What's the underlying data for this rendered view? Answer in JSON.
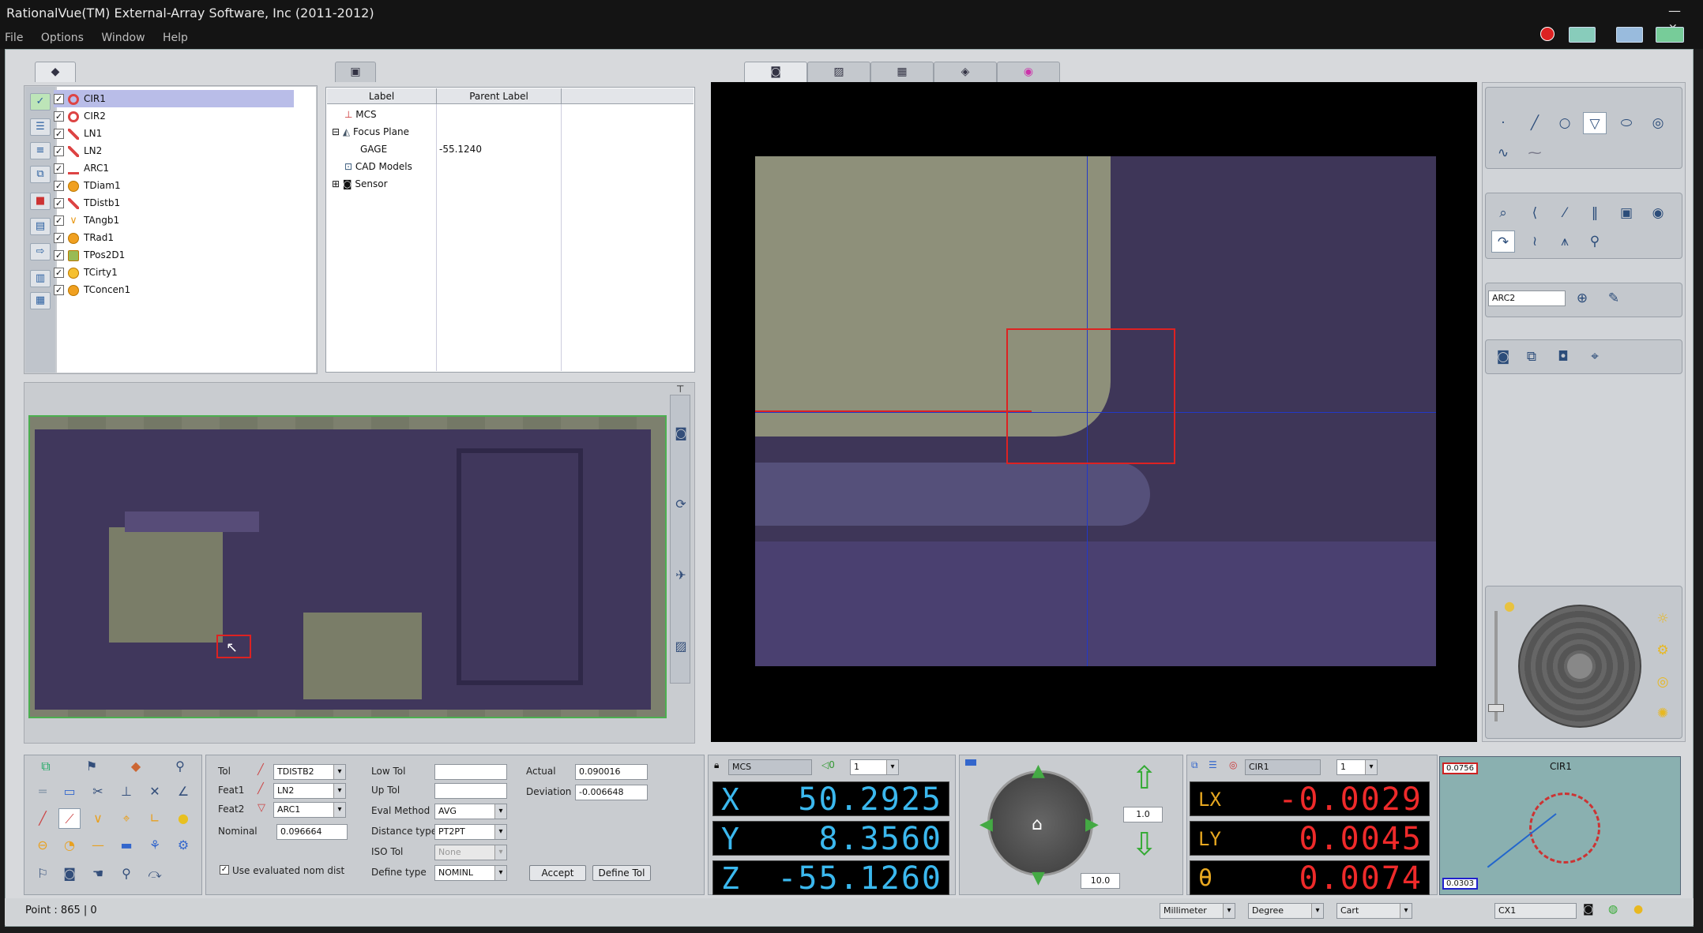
{
  "app": {
    "title": "RationalVue(TM) External-Array Software, Inc (2011-2012)"
  },
  "menu": [
    "File",
    "Options",
    "Window",
    "Help"
  ],
  "features": [
    {
      "label": "CIR1",
      "color": "#d44"
    },
    {
      "label": "CIR2",
      "color": "#d44"
    },
    {
      "label": "LN1",
      "color": "#d44"
    },
    {
      "label": "LN2",
      "color": "#d44"
    },
    {
      "label": "ARC1",
      "color": "#d44"
    },
    {
      "label": "TDiam1",
      "color": "#e89a1a"
    },
    {
      "label": "TDistb1",
      "color": "#d44"
    },
    {
      "label": "TAngb1",
      "color": "#e89a1a"
    },
    {
      "label": "TRad1",
      "color": "#e89a1a"
    },
    {
      "label": "TPos2D1",
      "color": "#e89a1a"
    },
    {
      "label": "TCirty1",
      "color": "#e89a1a"
    },
    {
      "label": "TConcen1",
      "color": "#e89a1a"
    }
  ],
  "props": {
    "col_label": "Label",
    "col_parent": "Parent Label",
    "rows": [
      {
        "label": "MCS",
        "parent": ""
      },
      {
        "label": "Focus Plane",
        "parent": ""
      },
      {
        "label": "GAGE",
        "parent": "-55.1240"
      },
      {
        "label": "CAD Models",
        "parent": ""
      },
      {
        "label": "Sensor",
        "parent": ""
      }
    ]
  },
  "vision": {
    "edit_value": "ARC2"
  },
  "tolerance": {
    "tol_label": "Tol",
    "tol_value": "TDISTB2",
    "feat1_label": "Feat1",
    "feat1_value": "LN2",
    "feat2_label": "Feat2",
    "feat2_value": "ARC1",
    "nominal_label": "Nominal",
    "nominal_value": "0.096664",
    "low_tol_label": "Low Tol",
    "low_tol_value": "",
    "up_tol_label": "Up Tol",
    "up_tol_value": "",
    "eval_label": "Eval Method",
    "eval_value": "AVG",
    "dist_type_label": "Distance type",
    "dist_type_value": "PT2PT",
    "iso_label": "ISO Tol",
    "iso_value": "None",
    "define_type_label": "Define type",
    "define_type_value": "NOMINL",
    "actual_label": "Actual",
    "actual_value": "0.090016",
    "deviation_label": "Deviation",
    "deviation_value": "-0.006648",
    "use_eval_label": "Use evaluated nom dist",
    "accept_label": "Accept",
    "define_tol_label": "Define Tol"
  },
  "dro": {
    "coord": "MCS",
    "coord_num": "1",
    "x_axis": "X",
    "y_axis": "Y",
    "z_axis": "Z",
    "x": "50.2925",
    "y": "8.3560",
    "z": "-55.1260"
  },
  "motion": {
    "step_fine": "1.0",
    "step_coarse": "10.0"
  },
  "feature_dro": {
    "feature": "CIR1",
    "num": "1",
    "lx_label": "LX",
    "ly_label": "LY",
    "theta_label": "θ",
    "lx": "-0.0029",
    "ly": "0.0045",
    "theta": "0.0074"
  },
  "plot": {
    "title": "CIR1",
    "upper": "0.0756",
    "lower": "0.0303"
  },
  "status": {
    "left": "Point : 865 | 0",
    "units": "Millimeter",
    "angle": "Degree",
    "mode": "Cart",
    "readout": "CX1"
  }
}
